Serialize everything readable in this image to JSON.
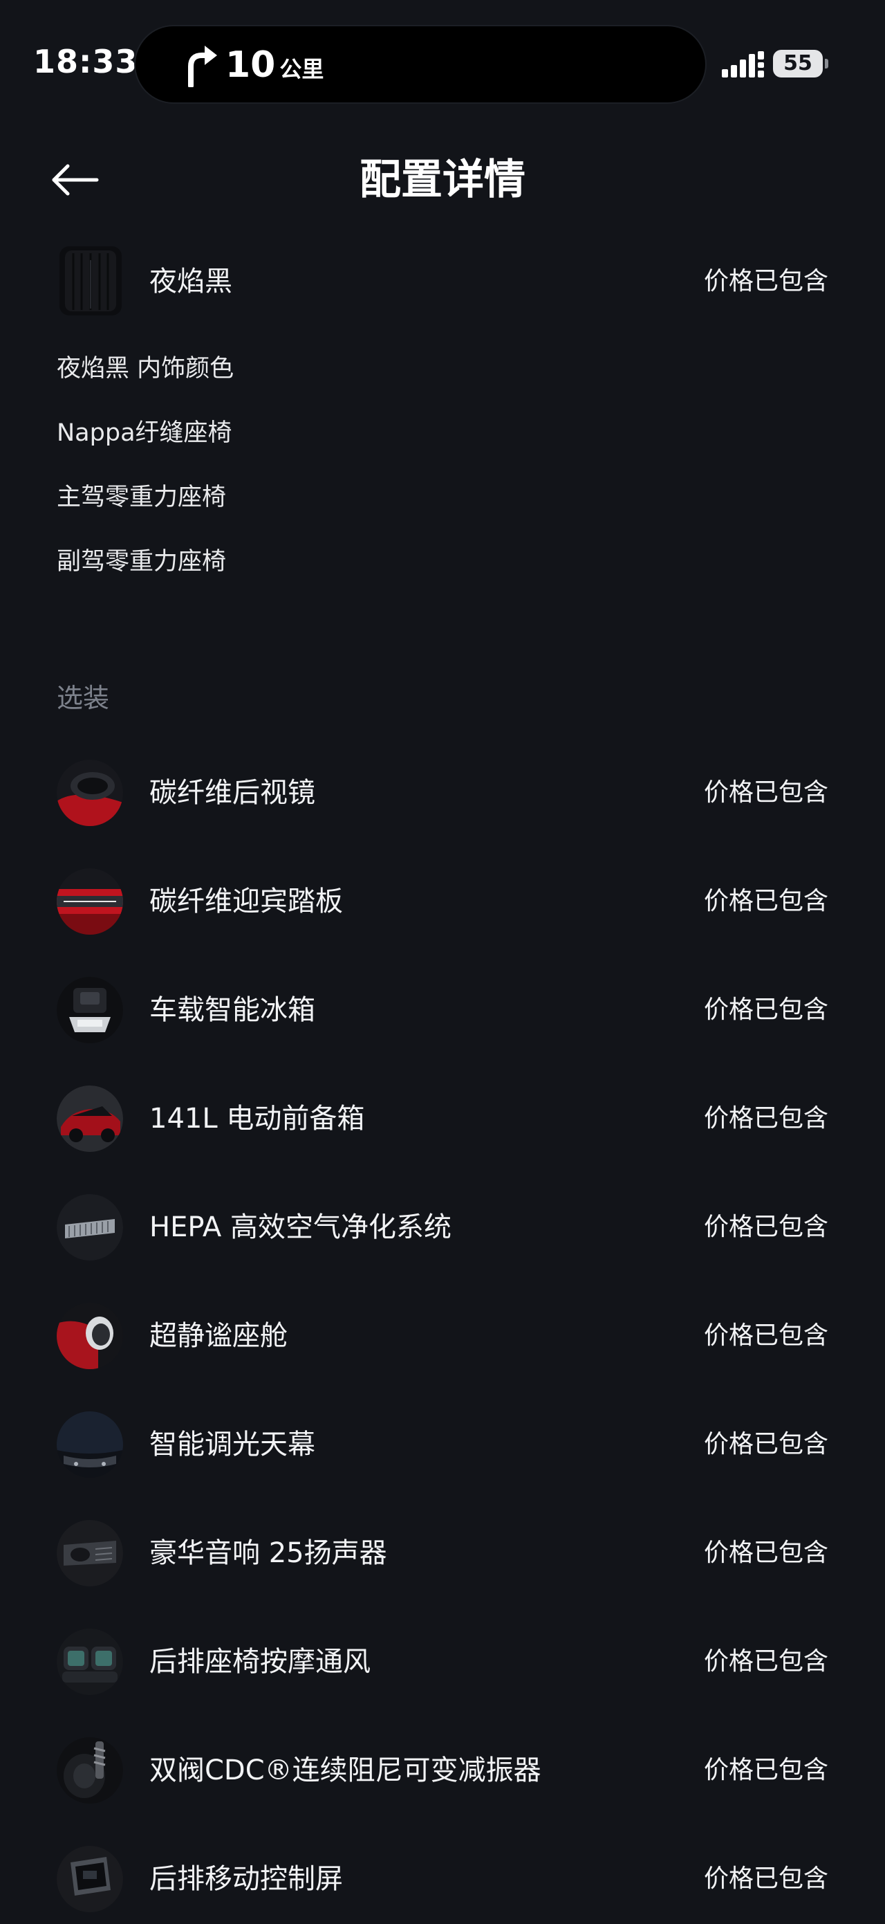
{
  "status_bar": {
    "time": "18:33",
    "nav_distance": "10",
    "nav_unit": "公里",
    "battery": "55"
  },
  "header": {
    "title": "配置详情"
  },
  "selected_color": {
    "label": "夜焰黑",
    "price": "价格已包含",
    "details": [
      "夜焰黑 内饰颜色",
      "Nappa纡缝座椅",
      "主驾零重力座椅",
      "副驾零重力座椅"
    ]
  },
  "options": {
    "section_title": "选装",
    "items": [
      {
        "label": "碳纤维后视镜",
        "price": "价格已包含",
        "icon": "carbon-mirror-thumb",
        "accent": "#b0121c"
      },
      {
        "label": "碳纤维迎宾踏板",
        "price": "价格已包含",
        "icon": "carbon-sill-thumb",
        "accent": "#c0141f"
      },
      {
        "label": "车载智能冰箱",
        "price": "价格已包含",
        "icon": "fridge-thumb",
        "accent": "#cfd2d6"
      },
      {
        "label": "141L 电动前备箱",
        "price": "价格已包含",
        "icon": "frunk-thumb",
        "accent": "#a3101a"
      },
      {
        "label": "HEPA 高效空气净化系统",
        "price": "价格已包含",
        "icon": "hepa-filter-thumb",
        "accent": "#9aa0a8"
      },
      {
        "label": "超静谧座舱",
        "price": "价格已包含",
        "icon": "quiet-cabin-thumb",
        "accent": "#a8141d"
      },
      {
        "label": "智能调光天幕",
        "price": "价格已包含",
        "icon": "sunroof-thumb",
        "accent": "#2b3442"
      },
      {
        "label": "豪华音响 25扬声器",
        "price": "价格已包含",
        "icon": "speaker-thumb",
        "accent": "#3a3d43"
      },
      {
        "label": "后排座椅按摩通风",
        "price": "价格已包含",
        "icon": "rear-seat-thumb",
        "accent": "#3d6f6a"
      },
      {
        "label": "双阀CDC®连续阻尼可变减振器",
        "price": "价格已包含",
        "icon": "damper-thumb",
        "accent": "#55585e"
      },
      {
        "label": "后排移动控制屏",
        "price": "价格已包含",
        "icon": "rear-screen-thumb",
        "accent": "#4a4e55"
      }
    ]
  }
}
